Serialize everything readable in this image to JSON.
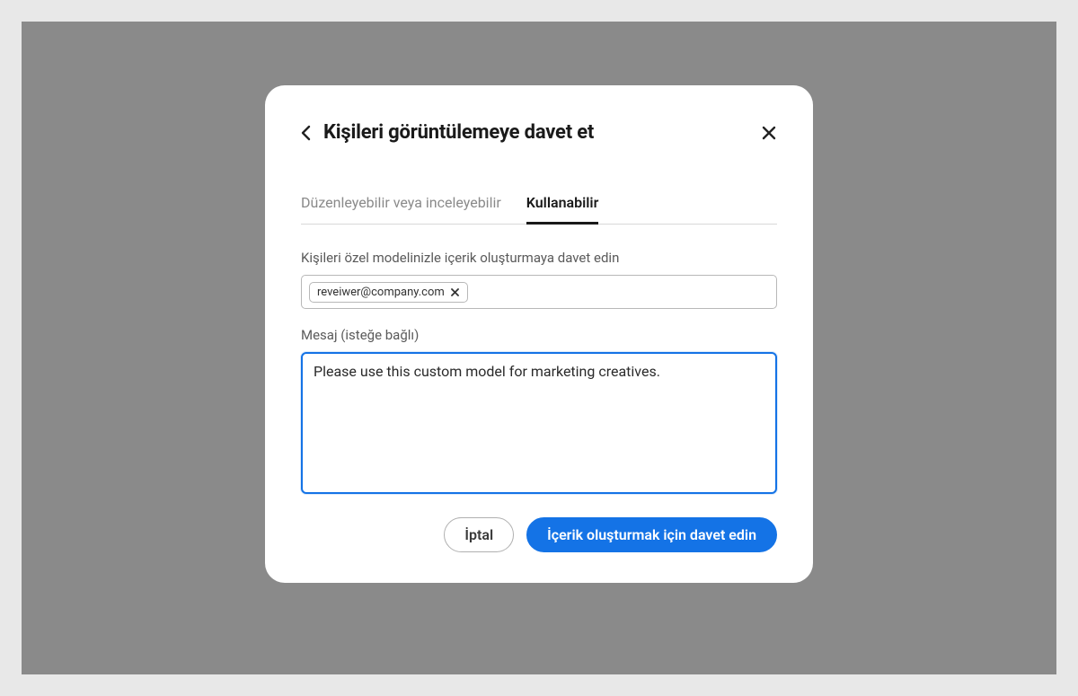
{
  "dialog": {
    "title": "Kişileri görüntülemeye davet et",
    "tabs": {
      "edit_review": "Düzenleyebilir veya inceleyebilir",
      "can_use": "Kullanabilir"
    },
    "invite_label": "Kişileri özel modelinizle içerik oluşturmaya davet edin",
    "email_chip": "reveiwer@company.com",
    "message_label": "Mesaj (isteğe bağlı)",
    "message_value": "Please use this custom model for marketing creatives.",
    "cancel_label": "İptal",
    "submit_label": "İçerik oluşturmak için davet edin"
  }
}
